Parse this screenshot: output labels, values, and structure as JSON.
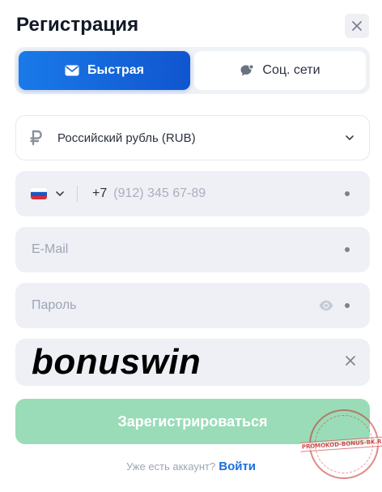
{
  "header": {
    "title": "Регистрация"
  },
  "tabs": [
    {
      "label": "Быстрая",
      "icon": "envelope-icon",
      "active": true
    },
    {
      "label": "Соц. сети",
      "icon": "chat-bubble-icon",
      "active": false
    }
  ],
  "currency": {
    "label": "Российский рубль (RUB)",
    "icon": "ruble-icon"
  },
  "phone": {
    "country": "Russia",
    "prefix": "+7",
    "placeholder": "(912) 345 67-89"
  },
  "email": {
    "placeholder": "E-Mail"
  },
  "password": {
    "placeholder": "Пароль"
  },
  "promo": {
    "value": "bonuswin"
  },
  "submit": {
    "label": "Зарегистрироваться"
  },
  "login": {
    "prompt": "Уже есть аккаунт?",
    "link": "Войти"
  },
  "watermark": {
    "text": "PROMOKOD-BONUS-BK.RU"
  },
  "colors": {
    "accent": "#1a6fe0",
    "submit_bg": "#9adcb8",
    "field_bg": "#eef0f6"
  }
}
